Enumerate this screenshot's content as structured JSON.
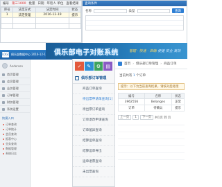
{
  "table_window": {
    "bar_items": [
      "编号",
      "第三1000",
      "批量",
      "日期",
      "年检人 单位",
      "查看结果"
    ],
    "columns": [
      "序号",
      "法定方式",
      "法定时间",
      "状态"
    ],
    "rows": [
      [
        "1",
        "法定受理",
        "2016-12-19",
        "提示"
      ]
    ]
  },
  "form_window": {
    "header": "查询条件",
    "row_labels": [
      "名称",
      "类型"
    ],
    "search_label": "查询"
  },
  "portal_window": {
    "topbar_logo": "LOGO",
    "topbar_text": "俱乐部数据中心 2016-12-19 网站建设 | 管理中心 | 退出",
    "user_name": "Anderson",
    "nav": [
      "首页管理",
      "会员管理",
      "业务管理",
      "订单管理",
      "财务管理",
      "系统设置"
    ],
    "subhead": "快捷入口",
    "sub_items": [
      "订单查询",
      "订单统计",
      "会员查询",
      "报表中心",
      "业务查询",
      "数据管理",
      "系统日志"
    ]
  },
  "header": {
    "title": "俱乐部电子对账系统",
    "slogan_left": "管理 · 快速 · 准确",
    "slogan_right": "便捷 安全 高效"
  },
  "nav": {
    "tile_icons": [
      "check-icon",
      "edit-icon",
      "gear-icon",
      "chart-icon"
    ],
    "tile_colors": [
      "#e25a3d",
      "#2f8fd6",
      "#3ea35e",
      "#8a5bc4"
    ],
    "section": "俱乐部订单管理",
    "items": [
      "商品订单查询",
      "待出票申请单查询[1]",
      "待出票订单查询",
      "订单退改申请查询",
      "订单差异查询",
      "结算运单查询",
      "结算运单导出",
      "运单退票查询",
      "未出票查询"
    ],
    "active_index": 1
  },
  "main": {
    "crumb_home": "首页",
    "crumb_items": [
      "俱乐部订单管理",
      "商品订单"
    ],
    "info_prefix": "当前共有",
    "info_count": "1",
    "info_suffix": "个订单",
    "notice": "提示：以下为当前查询结果，请核对后处理",
    "columns": [
      "编号",
      "名称",
      "状态"
    ],
    "rows": [
      [
        "3962556",
        "Belanges",
        "正常"
      ],
      [
        "订单",
        "待确认",
        "提示"
      ]
    ],
    "pager": {
      "prev": "上一页",
      "page": "1",
      "next": "下一页",
      "info": "共1页 到 页"
    }
  }
}
